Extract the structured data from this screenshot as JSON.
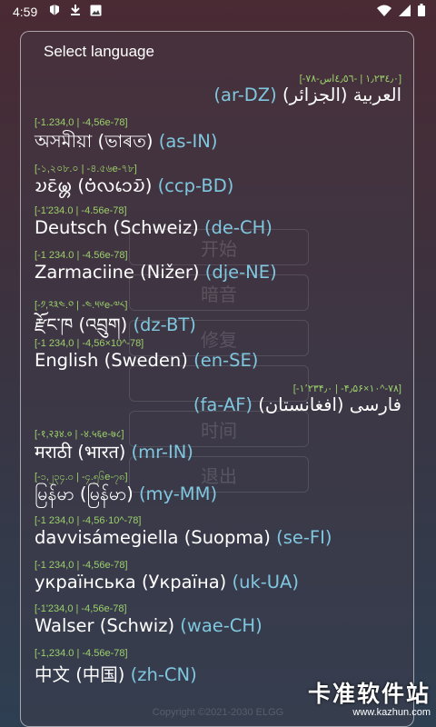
{
  "status_bar": {
    "time": "4:59",
    "left_icons": [
      "app-notification-icon",
      "download-icon",
      "image-icon"
    ],
    "right_icons": [
      "wifi-icon",
      "signal-icon",
      "battery-icon"
    ]
  },
  "background": {
    "buttons": [
      "开始",
      "暗音",
      "修复",
      "",
      "时间",
      "退出"
    ],
    "copyright": "Copyright ©2021-2030 ELGG"
  },
  "dialog": {
    "title": "Select language",
    "languages": [
      {
        "sample": "[-١٫٢٣٤٫٠ | -٤٫٥٦اس-٧٨]",
        "native": "العربية (الجزائر)",
        "code": "(ar-DZ)",
        "rtl": true
      },
      {
        "sample": "[-1.234,0 | -4,56e-78]",
        "native": "অসমীয়া (ভাৰত)",
        "code": "(as-IN)",
        "rtl": false
      },
      {
        "sample": "[-১,২০৮.০ | -৪.৫৬e-৭৮]",
        "native": "𑄌𑄋𑄴𑄟𑄳𑄦 (𑄝𑄁𑄣𑄘𑄬𑄌𑄴)",
        "code": "(ccp-BD)",
        "rtl": false
      },
      {
        "sample": "[-1'234.0 | -4.56e-78]",
        "native": "Deutsch (Schweiz)",
        "code": "(de-CH)",
        "rtl": false
      },
      {
        "sample": "[-1 234.0 | -4.56e-78]",
        "native": "Zarmaciine (Nižer)",
        "code": "(dje-NE)",
        "rtl": false
      },
      {
        "sample": "[-༡,༢༣༤.༠ | -༤.༥༦e-༧༨]",
        "native": "རྫོང་ཁ (འབྲུག)",
        "code": "(dz-BT)",
        "rtl": false
      },
      {
        "sample": "[-1 234,0 | -4,56×10^-78]",
        "native": "English (Sweden)",
        "code": "(en-SE)",
        "rtl": false
      },
      {
        "sample": "[-۱٬۲۳۴٫۰ | -۴٫۵۶×۱۰^-۷۸]",
        "native": "فارسی (افغانستان)",
        "code": "(fa-AF)",
        "rtl": true
      },
      {
        "sample": "[-१,२३४.० | -४.५६e-७८]",
        "native": "मराठी (भारत)",
        "code": "(mr-IN)",
        "rtl": false
      },
      {
        "sample": "[-၁,၂၃၄.၀ | -၄.၅၆e-၇၈]",
        "native": "မြန်မာ (မြန်မာ)",
        "code": "(my-MM)",
        "rtl": false
      },
      {
        "sample": "[-1 234,0 | -4,56·10^-78]",
        "native": "davvisámegiella (Suopma)",
        "code": "(se-FI)",
        "rtl": false
      },
      {
        "sample": "[-1 234,0 | -4,56e-78]",
        "native": "українська (Україна)",
        "code": "(uk-UA)",
        "rtl": false
      },
      {
        "sample": "[-1'234,0 | -4,56e-78]",
        "native": "Walser (Schwiz)",
        "code": "(wae-CH)",
        "rtl": false
      },
      {
        "sample": "[-1,234.0 | -4.56e-78]",
        "native": "中文 (中国)",
        "code": "(zh-CN)",
        "rtl": false
      }
    ]
  },
  "watermark": {
    "main": "卡准软件站",
    "url": "www.kazhun.com"
  },
  "colors": {
    "sample_text": "#9bd06a",
    "code_text": "#7fc7df"
  }
}
